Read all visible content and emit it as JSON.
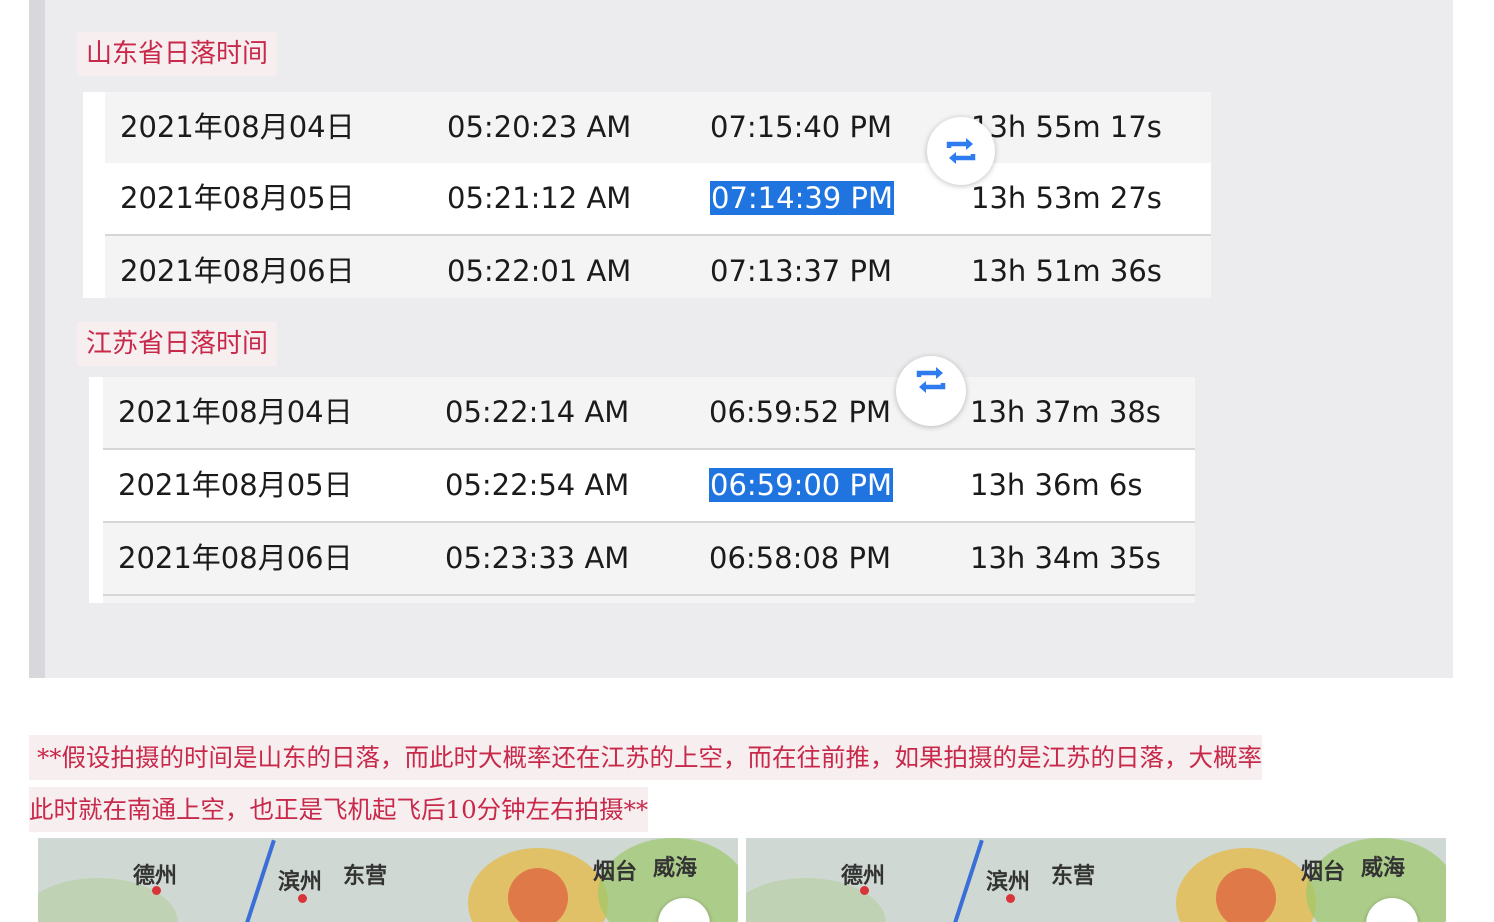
{
  "tables": [
    {
      "title": "山东省日落时间",
      "rows": [
        {
          "date": "2021年08月04日",
          "sunrise": "05:20:23 AM",
          "sunset": "07:15:40 PM",
          "duration": "13h 55m 17s",
          "selected": false
        },
        {
          "date": "2021年08月05日",
          "sunrise": "05:21:12 AM",
          "sunset": "07:14:39 PM",
          "duration": "13h 53m 27s",
          "selected": true
        },
        {
          "date": "2021年08月06日",
          "sunrise": "05:22:01 AM",
          "sunset": "07:13:37 PM",
          "duration": "13h 51m 36s",
          "selected": false
        }
      ]
    },
    {
      "title": "江苏省日落时间",
      "rows": [
        {
          "date": "2021年08月04日",
          "sunrise": "05:22:14 AM",
          "sunset": "06:59:52 PM",
          "duration": "13h 37m 38s",
          "selected": false
        },
        {
          "date": "2021年08月05日",
          "sunrise": "05:22:54 AM",
          "sunset": "06:59:00 PM",
          "duration": "13h 36m 6s",
          "selected": true
        },
        {
          "date": "2021年08月06日",
          "sunrise": "05:23:33 AM",
          "sunset": "06:58:08 PM",
          "duration": "13h 34m 35s",
          "selected": false
        }
      ]
    }
  ],
  "note": {
    "line1": "**假设拍摄的时间是山东的日落，而此时大概率还在江苏的上空，而在往前推，如果拍摄的是江苏的日落，大概率",
    "line2": "此时就在南通上空，也正是飞机起飞后10分钟左右拍摄**"
  },
  "maps": [
    {
      "labels": {
        "dezhou": "德州",
        "binzhou": "滨州",
        "dongying": "东营",
        "yantai": "烟台",
        "weihai": "威海"
      }
    },
    {
      "labels": {
        "dezhou": "德州",
        "binzhou": "滨州",
        "dongying": "东营",
        "yantai": "烟台",
        "weihai": "威海"
      }
    }
  ],
  "colors": {
    "accent": "#c8294b",
    "selection": "#1f74e0",
    "swap_icon": "#2f7cf0"
  },
  "icons": {
    "swap": "swap-arrows-icon"
  }
}
